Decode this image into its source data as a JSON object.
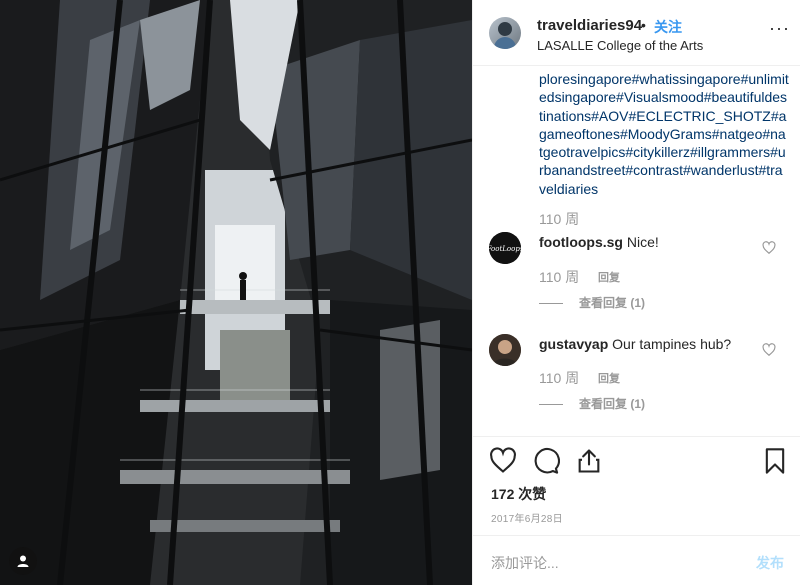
{
  "post": {
    "username": "traveldiaries94",
    "separator": "•",
    "follow_label": "关注",
    "location": "LASALLE College of the Arts",
    "more_label": "···"
  },
  "caption": {
    "text": "ploresingapore#whatissingapore#unlimitedsingapore#Visualsmood#beautifuldestinations#AOV#ECLECTRIC_SHOTZ#agameoftones#MoodyGrams#natgeo#natgeotravelpics#citykillerz#illgrammers#urbanandstreet#contrast#wanderlust#traveldiaries",
    "time": "110 周"
  },
  "comments": [
    {
      "username": "footloops.sg",
      "text": "Nice!",
      "avatar_text": "FootLoops",
      "time": "110 周",
      "reply_label": "回复",
      "view_replies": "查看回复 (1)"
    },
    {
      "username": "gustavyap",
      "text": "Our tampines hub?",
      "time": "110 周",
      "reply_label": "回复",
      "view_replies": "查看回复 (1)"
    }
  ],
  "actions": {
    "like_icon": "heart-icon",
    "comment_icon": "comment-icon",
    "share_icon": "share-icon",
    "save_icon": "bookmark-icon"
  },
  "likes_label": "172 次赞",
  "date": "2017年6月28日",
  "add_comment": {
    "placeholder": "添加评论...",
    "post_label": "发布"
  },
  "colors": {
    "link": "#003569",
    "follow": "#3897f0",
    "muted": "#999999",
    "post_disabled": "#b2dffc"
  }
}
